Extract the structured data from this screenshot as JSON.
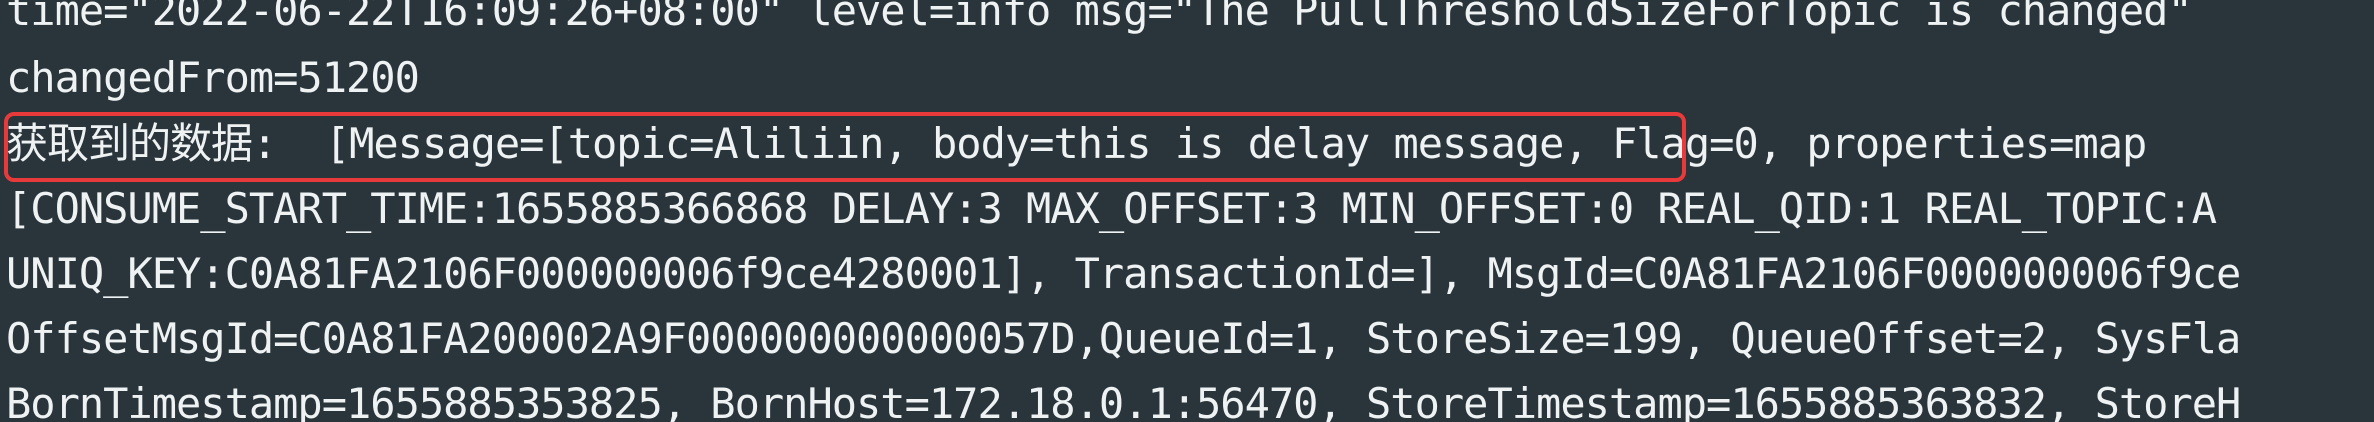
{
  "terminal": {
    "lines": [
      "time=\"2022-06-22T16:09:26+08:00\" level=info msg=\"The PullThresholdSizeForTopic is changed\" ",
      "changedFrom=51200",
      "获取到的数据:  [Message=[topic=Aliliin, body=this is delay message, Flag=0, properties=map",
      "[CONSUME_START_TIME:1655885366868 DELAY:3 MAX_OFFSET:3 MIN_OFFSET:0 REAL_QID:1 REAL_TOPIC:A",
      "UNIQ_KEY:C0A81FA2106F000000006f9ce4280001], TransactionId=], MsgId=C0A81FA2106F000000006f9ce",
      "OffsetMsgId=C0A81FA200002A9F000000000000057D,QueueId=1, StoreSize=199, QueueOffset=2, SysFla",
      "BornTimestamp=1655885353825, BornHost=172.18.0.1:56470, StoreTimestamp=1655885363832, StoreH"
    ],
    "highlight_color": "#e83a3a",
    "background_color": "#2a353b",
    "text_color": "#eef2f3"
  }
}
